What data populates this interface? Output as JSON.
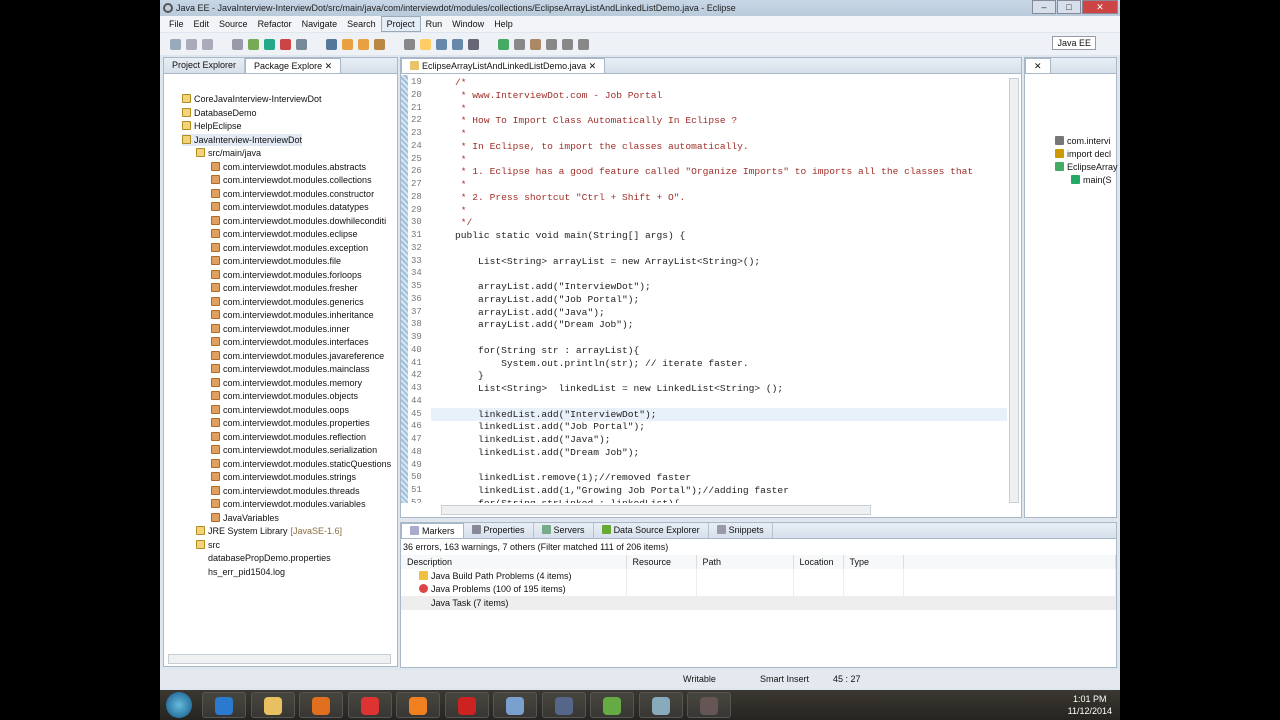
{
  "window": {
    "title": "Java EE - JavaInterview-InterviewDot/src/main/java/com/interviewdot/modules/collections/EclipseArrayListAndLinkedListDemo.java - Eclipse"
  },
  "menu": [
    "File",
    "Edit",
    "Source",
    "Refactor",
    "Navigate",
    "Search",
    "Project",
    "Run",
    "Window",
    "Help"
  ],
  "perspective": "Java EE",
  "left_panel": {
    "tabs": [
      "Project Explorer",
      "Package Explore"
    ],
    "projects": [
      "CoreJavaInterview-InterviewDot",
      "DatabaseDemo",
      "HelpEclipse",
      "JavaInterview-InterviewDot"
    ],
    "source_folder": "src/main/java",
    "packages": [
      "com.interviewdot.modules.abstracts",
      "com.interviewdot.modules.collections",
      "com.interviewdot.modules.constructor",
      "com.interviewdot.modules.datatypes",
      "com.interviewdot.modules.dowhileconditi",
      "com.interviewdot.modules.eclipse",
      "com.interviewdot.modules.exception",
      "com.interviewdot.modules.file",
      "com.interviewdot.modules.forloops",
      "com.interviewdot.modules.fresher",
      "com.interviewdot.modules.generics",
      "com.interviewdot.modules.inheritance",
      "com.interviewdot.modules.inner",
      "com.interviewdot.modules.interfaces",
      "com.interviewdot.modules.javareference",
      "com.interviewdot.modules.mainclass",
      "com.interviewdot.modules.memory",
      "com.interviewdot.modules.objects",
      "com.interviewdot.modules.oops",
      "com.interviewdot.modules.properties",
      "com.interviewdot.modules.reflection",
      "com.interviewdot.modules.serialization",
      "com.interviewdot.modules.staticQuestions",
      "com.interviewdot.modules.strings",
      "com.interviewdot.modules.threads",
      "com.interviewdot.modules.variables",
      "JavaVariables"
    ],
    "jre": "JRE System Library",
    "jre_version": "[JavaSE-1.6]",
    "others": [
      "src",
      "databasePropDemo.properties",
      "hs_err_pid1504.log"
    ]
  },
  "editor": {
    "tab": "EclipseArrayListAndLinkedListDemo.java",
    "lines": [
      {
        "n": "19",
        "t": "    /*",
        "c": "cm"
      },
      {
        "n": "20",
        "t": "     * www.InterviewDot.com - Job Portal",
        "c": "cm"
      },
      {
        "n": "21",
        "t": "     *",
        "c": "cm"
      },
      {
        "n": "22",
        "t": "     * How To Import Class Automatically In Eclipse ?",
        "c": "cm"
      },
      {
        "n": "23",
        "t": "     *",
        "c": "cm"
      },
      {
        "n": "24",
        "t": "     * In Eclipse, to import the classes automatically.",
        "c": "cm"
      },
      {
        "n": "25",
        "t": "     *",
        "c": "cm"
      },
      {
        "n": "26",
        "t": "     * 1. Eclipse has a good feature called \"Organize Imports\" to imports all the classes that",
        "c": "cm"
      },
      {
        "n": "27",
        "t": "     *",
        "c": "cm"
      },
      {
        "n": "28",
        "t": "     * 2. Press shortcut \"Ctrl + Shift + O\".",
        "c": "cm"
      },
      {
        "n": "29",
        "t": "     *",
        "c": "cm"
      },
      {
        "n": "30",
        "t": "     */",
        "c": "cm"
      },
      {
        "n": "31",
        "t": "    public static void main(String[] args) {",
        "c": ""
      },
      {
        "n": "32",
        "t": "",
        "c": ""
      },
      {
        "n": "33",
        "t": "        List<String> arrayList = new ArrayList<String>();",
        "c": ""
      },
      {
        "n": "34",
        "t": "",
        "c": ""
      },
      {
        "n": "35",
        "t": "        arrayList.add(\"InterviewDot\");",
        "c": ""
      },
      {
        "n": "36",
        "t": "        arrayList.add(\"Job Portal\");",
        "c": ""
      },
      {
        "n": "37",
        "t": "        arrayList.add(\"Java\");",
        "c": ""
      },
      {
        "n": "38",
        "t": "        arrayList.add(\"Dream Job\");",
        "c": ""
      },
      {
        "n": "39",
        "t": "",
        "c": ""
      },
      {
        "n": "40",
        "t": "        for(String str : arrayList){",
        "c": ""
      },
      {
        "n": "41",
        "t": "            System.out.println(str); // iterate faster.",
        "c": ""
      },
      {
        "n": "42",
        "t": "        }",
        "c": ""
      },
      {
        "n": "43",
        "t": "        List<String>  linkedList = new LinkedList<String> ();",
        "c": ""
      },
      {
        "n": "44",
        "t": "",
        "c": ""
      },
      {
        "n": "45",
        "t": "        linkedList.add(\"InterviewDot\");",
        "c": ""
      },
      {
        "n": "46",
        "t": "        linkedList.add(\"Job Portal\");",
        "c": ""
      },
      {
        "n": "47",
        "t": "        linkedList.add(\"Java\");",
        "c": ""
      },
      {
        "n": "48",
        "t": "        linkedList.add(\"Dream Job\");",
        "c": ""
      },
      {
        "n": "49",
        "t": "",
        "c": ""
      },
      {
        "n": "50",
        "t": "        linkedList.remove(1);//removed faster",
        "c": ""
      },
      {
        "n": "51",
        "t": "        linkedList.add(1,\"Growing Job Portal\");//adding faster",
        "c": ""
      },
      {
        "n": "52",
        "t": "        for(String strLinked : linkedList){",
        "c": ""
      }
    ]
  },
  "outline": {
    "items": [
      "com.intervi",
      "import decl",
      "EclipseArray",
      "main(S"
    ]
  },
  "bottom": {
    "tabs": [
      "Markers",
      "Properties",
      "Servers",
      "Data Source Explorer",
      "Snippets"
    ],
    "summary": "36 errors, 163 warnings, 7 others (Filter matched 111 of 206 items)",
    "columns": [
      "Description",
      "Resource",
      "Path",
      "Location",
      "Type"
    ],
    "rows": [
      "Java Build Path Problems (4 items)",
      "Java Problems (100 of 195 items)",
      "Java Task (7 items)"
    ]
  },
  "status": {
    "mode": "Writable",
    "insert": "Smart Insert",
    "position": "45 : 27"
  },
  "taskbar": {
    "time": "1:01 PM",
    "date": "11/12/2014"
  }
}
